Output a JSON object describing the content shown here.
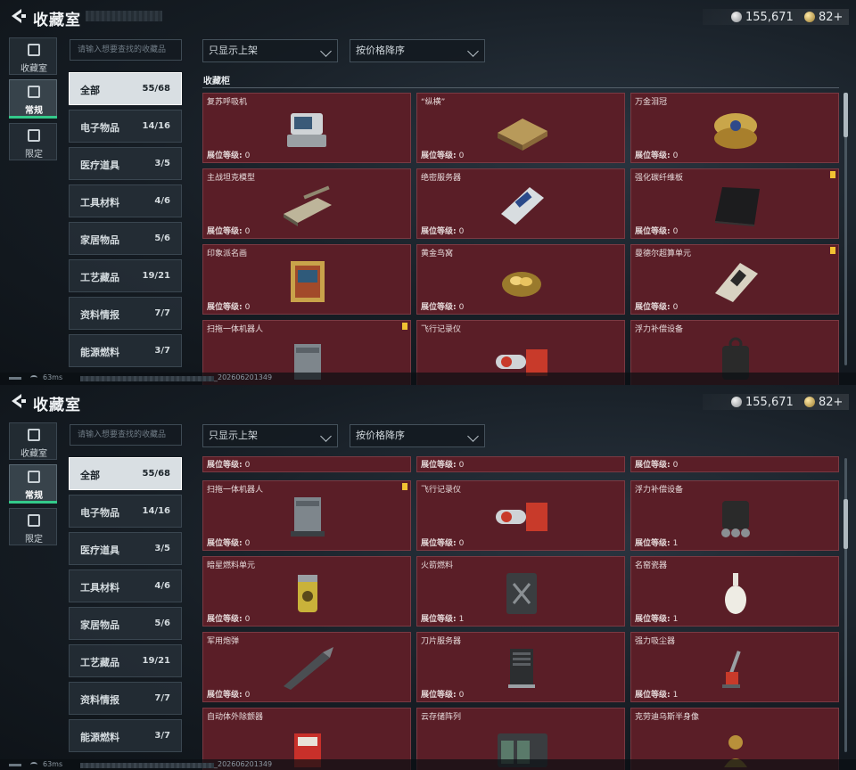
{
  "header": {
    "title": "收藏室",
    "currency_silver": "155,671",
    "currency_gold": "82+"
  },
  "rail": [
    {
      "label": "收藏室",
      "icon": "collection-icon"
    },
    {
      "label": "常规",
      "icon": "regular-icon"
    },
    {
      "label": "限定",
      "icon": "limited-icon"
    }
  ],
  "search": {
    "placeholder": "请输入想要查找的收藏品"
  },
  "filters": {
    "shelf": "只显示上架",
    "sort": "按价格降序"
  },
  "categories": [
    {
      "name": "全部",
      "count": "55/68"
    },
    {
      "name": "电子物品",
      "count": "14/16"
    },
    {
      "name": "医疗道具",
      "count": "3/5"
    },
    {
      "name": "工具材料",
      "count": "4/6"
    },
    {
      "name": "家居物品",
      "count": "5/6"
    },
    {
      "name": "工艺藏品",
      "count": "19/21"
    },
    {
      "name": "资料情报",
      "count": "7/7"
    },
    {
      "name": "能源燃料",
      "count": "3/7"
    }
  ],
  "section_title": "收藏柜",
  "level_label": "展位等级:",
  "status": {
    "ping": "63ms",
    "version": "_202606201349"
  },
  "screen1_items": [
    {
      "name": "复苏呼吸机",
      "level": "0"
    },
    {
      "name": "“纵横”",
      "level": "0"
    },
    {
      "name": "万金泪冠",
      "level": "0"
    },
    {
      "name": "主战坦克模型",
      "level": "0"
    },
    {
      "name": "绝密服务器",
      "level": "0"
    },
    {
      "name": "强化碳纤维板",
      "level": "0"
    },
    {
      "name": "印象派名画",
      "level": "0"
    },
    {
      "name": "黄金鸟窝",
      "level": "0"
    },
    {
      "name": "曼德尔超算单元",
      "level": "0"
    },
    {
      "name": "扫拖一体机器人",
      "level": ""
    },
    {
      "name": "飞行记录仪",
      "level": ""
    },
    {
      "name": "浮力补偿设备",
      "level": ""
    }
  ],
  "screen2_items": [
    {
      "name": "",
      "level": "0"
    },
    {
      "name": "",
      "level": "0"
    },
    {
      "name": "",
      "level": "0"
    },
    {
      "name": "扫拖一体机器人",
      "level": "0"
    },
    {
      "name": "飞行记录仪",
      "level": "0"
    },
    {
      "name": "浮力补偿设备",
      "level": "1"
    },
    {
      "name": "暗星燃料单元",
      "level": "0"
    },
    {
      "name": "火箭燃料",
      "level": "1"
    },
    {
      "name": "名窑瓷器",
      "level": "1"
    },
    {
      "name": "军用炮弹",
      "level": "0"
    },
    {
      "name": "刀片服务器",
      "level": "0"
    },
    {
      "name": "强力吸尘器",
      "level": "1"
    },
    {
      "name": "自动体外除颤器",
      "level": ""
    },
    {
      "name": "云存储阵列",
      "level": ""
    },
    {
      "name": "克劳迪乌斯半身像",
      "level": ""
    }
  ]
}
